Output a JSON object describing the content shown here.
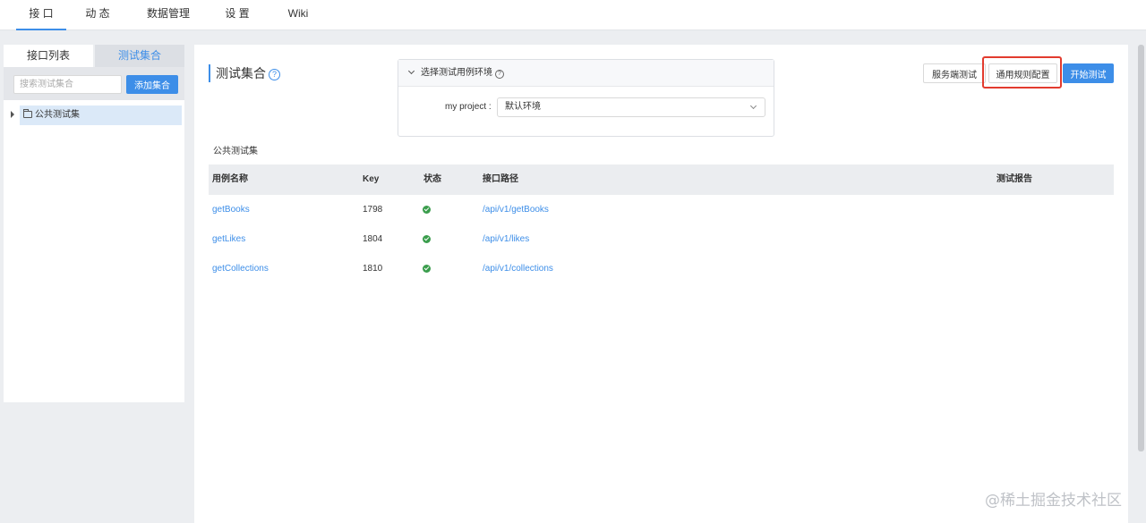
{
  "topnav": {
    "tabs": [
      {
        "label": "接 口"
      },
      {
        "label": "动 态"
      },
      {
        "label": "数据管理"
      },
      {
        "label": "设 置"
      },
      {
        "label": "Wiki"
      }
    ]
  },
  "sidebar": {
    "tab_list": "接口列表",
    "tab_collection": "测试集合",
    "search_placeholder": "搜索测试集合",
    "add_label": "添加集合",
    "tree_item": "公共测试集"
  },
  "main": {
    "title": "测试集合",
    "help_glyph": "?",
    "env_box": {
      "header": "选择测试用例环境",
      "help_glyph": "?",
      "project_label": "my project :",
      "selected_env": "默认环境"
    },
    "buttons": {
      "server_test": "服务端测试",
      "rule_config": "通用规则配置",
      "start_test": "开始测试"
    },
    "set_name": "公共测试集",
    "table": {
      "headers": {
        "name": "用例名称",
        "key": "Key",
        "status": "状态",
        "path": "接口路径",
        "report": "测试报告"
      },
      "rows": [
        {
          "name": "getBooks",
          "key": "1798",
          "status": "success",
          "path": "/api/v1/getBooks"
        },
        {
          "name": "getLikes",
          "key": "1804",
          "status": "success",
          "path": "/api/v1/likes"
        },
        {
          "name": "getCollections",
          "key": "1810",
          "status": "success",
          "path": "/api/v1/collections"
        }
      ]
    }
  },
  "colors": {
    "accent": "#3d8ee8",
    "highlight": "#e23b2e",
    "success": "#3a9d4c"
  },
  "watermark": "@稀土掘金技术社区"
}
